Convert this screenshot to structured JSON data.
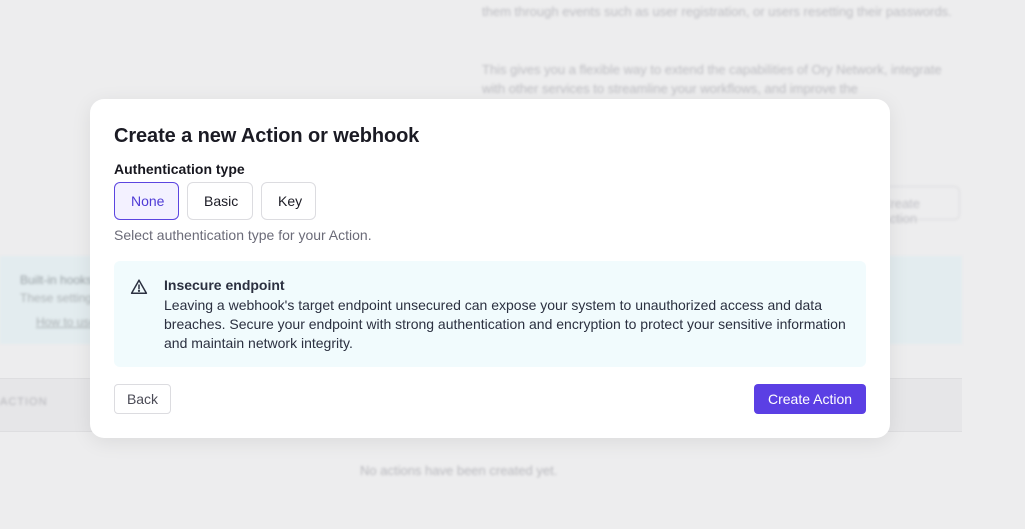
{
  "background": {
    "paragraph_1": "them through events such as user registration, or users resetting their passwords.",
    "paragraph_2": "This gives you a flexible way to extend the capabilities of Ory Network, integrate with other services to streamline your workflows, and improve the",
    "create_button_label": "Create Action",
    "band_title": "Built-in hooks",
    "band_text": "These settings",
    "band_link": "How to use",
    "table_header": "ACTION",
    "empty_message": "No actions have been created yet."
  },
  "modal": {
    "title": "Create a new Action or webhook",
    "auth_label": "Authentication type",
    "auth_options": [
      {
        "label": "None",
        "selected": true
      },
      {
        "label": "Basic",
        "selected": false
      },
      {
        "label": "Key",
        "selected": false
      }
    ],
    "auth_help": "Select authentication type for your Action.",
    "alert": {
      "icon": "warning-triangle-icon",
      "title": "Insecure endpoint",
      "body": "Leaving a webhook's target endpoint unsecured can expose your system to unauthorized access and data breaches. Secure your endpoint with strong authentication and encryption to protect your sensitive information and maintain network integrity."
    },
    "back_label": "Back",
    "create_label": "Create Action"
  },
  "colors": {
    "accent": "#5b3fe4",
    "alert_bg": "#f1fbfd",
    "overlay": "#ededee"
  }
}
